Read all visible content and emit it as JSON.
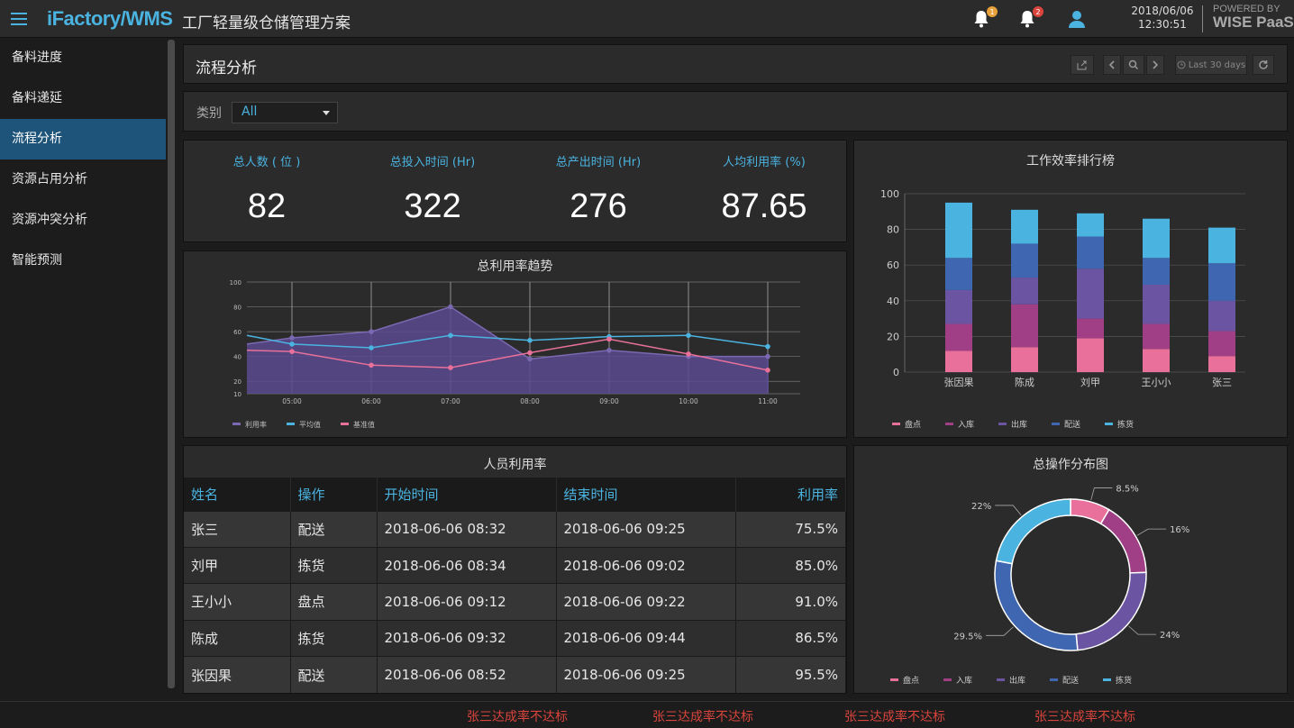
{
  "header": {
    "brand": "iFactory/WMS",
    "subtitle": "工厂轻量级仓储管理方案",
    "notif1_count": "1",
    "notif2_count": "2",
    "date": "2018/06/06",
    "time": "12:30:51",
    "powered_by": "POWERED BY",
    "platform": "WISE PaaS"
  },
  "sidebar": {
    "items": [
      {
        "label": "备料进度"
      },
      {
        "label": "备料递延"
      },
      {
        "label": "流程分析"
      },
      {
        "label": "资源占用分析"
      },
      {
        "label": "资源冲突分析"
      },
      {
        "label": "智能预测"
      }
    ],
    "active_index": 2
  },
  "page": {
    "title": "流程分析",
    "time_range": "Last 30 days"
  },
  "filter": {
    "label": "类别",
    "value": "All"
  },
  "kpis": [
    {
      "label": "总人数 ( 位 )",
      "value": "82"
    },
    {
      "label": "总投入时间 (Hr)",
      "value": "322"
    },
    {
      "label": "总产出时间 (Hr)",
      "value": "276"
    },
    {
      "label": "人均利用率 (%)",
      "value": "87.65"
    }
  ],
  "colors": {
    "accent": "#4ab3e0",
    "util": "#5b4a8f",
    "avg": "#4ab3e0",
    "base": "#e8709a",
    "pandian": "#e8709a",
    "ruku": "#a03f85",
    "chuku": "#6b55a3",
    "peisong": "#3f66b0",
    "jianhuo": "#4ab3e0",
    "alert": "#d9443c"
  },
  "trend_chart": {
    "title": "总利用率趋势",
    "chart_data": {
      "type": "line",
      "x": [
        "05:00",
        "06:00",
        "07:00",
        "08:00",
        "09:00",
        "10:00",
        "11:00"
      ],
      "ylim": [
        10,
        100
      ],
      "yticks": [
        10,
        20,
        40,
        60,
        80,
        100
      ],
      "series": [
        {
          "name": "利用率",
          "values": [
            55,
            60,
            80,
            38,
            45,
            40,
            40
          ],
          "start": 50
        },
        {
          "name": "平均值",
          "values": [
            50,
            47,
            57,
            53,
            56,
            57,
            48
          ],
          "start": 57
        },
        {
          "name": "基准值",
          "values": [
            44,
            33,
            31,
            43,
            54,
            42,
            29
          ],
          "start": 45
        }
      ],
      "legend": "bottom-left",
      "grid": true
    }
  },
  "rank_chart": {
    "title": "工作效率排行榜",
    "chart_data": {
      "type": "bar",
      "stacked": true,
      "categories": [
        "张因果",
        "陈成",
        "刘甲",
        "王小小",
        "张三"
      ],
      "ylim": [
        0,
        100
      ],
      "yticks": [
        0,
        20,
        40,
        60,
        80,
        100
      ],
      "series": [
        {
          "name": "盘点",
          "values": [
            12,
            14,
            19,
            13,
            9
          ]
        },
        {
          "name": "入库",
          "values": [
            15,
            24,
            11,
            14,
            14
          ]
        },
        {
          "name": "出库",
          "values": [
            19,
            15,
            28,
            22,
            17
          ]
        },
        {
          "name": "配送",
          "values": [
            18,
            19,
            18,
            15,
            21
          ]
        },
        {
          "name": "拣货",
          "values": [
            31,
            19,
            13,
            22,
            20
          ]
        }
      ],
      "legend": "bottom-left",
      "grid": true
    }
  },
  "table": {
    "title": "人员利用率",
    "headers": [
      "姓名",
      "操作",
      "开始时间",
      "结束时间",
      "利用率"
    ],
    "rows": [
      [
        "张三",
        "配送",
        "2018-06-06  08:32",
        "2018-06-06  09:25",
        "75.5%"
      ],
      [
        "刘甲",
        "拣货",
        "2018-06-06  08:34",
        "2018-06-06  09:02",
        "85.0%"
      ],
      [
        "王小小",
        "盘点",
        "2018-06-06  09:12",
        "2018-06-06  09:22",
        "91.0%"
      ],
      [
        "陈成",
        "拣货",
        "2018-06-06  09:32",
        "2018-06-06  09:44",
        "86.5%"
      ],
      [
        "张因果",
        "配送",
        "2018-06-06  08:52",
        "2018-06-06  09:25",
        "95.5%"
      ]
    ]
  },
  "donut_chart": {
    "title": "总操作分布图",
    "chart_data": {
      "type": "pie",
      "donut": true,
      "slices": [
        {
          "name": "盘点",
          "value": 8.5,
          "label": "8.5%"
        },
        {
          "name": "入库",
          "value": 16,
          "label": "16%"
        },
        {
          "name": "出库",
          "value": 24,
          "label": "24%"
        },
        {
          "name": "配送",
          "value": 29.5,
          "label": "29.5%"
        },
        {
          "name": "拣货",
          "value": 22,
          "label": "22%"
        }
      ],
      "legend": "bottom-left"
    }
  },
  "ticker": {
    "messages": [
      "张三达成率不达标",
      "张三达成率不达标",
      "张三达成率不达标",
      "张三达成率不达标"
    ]
  }
}
